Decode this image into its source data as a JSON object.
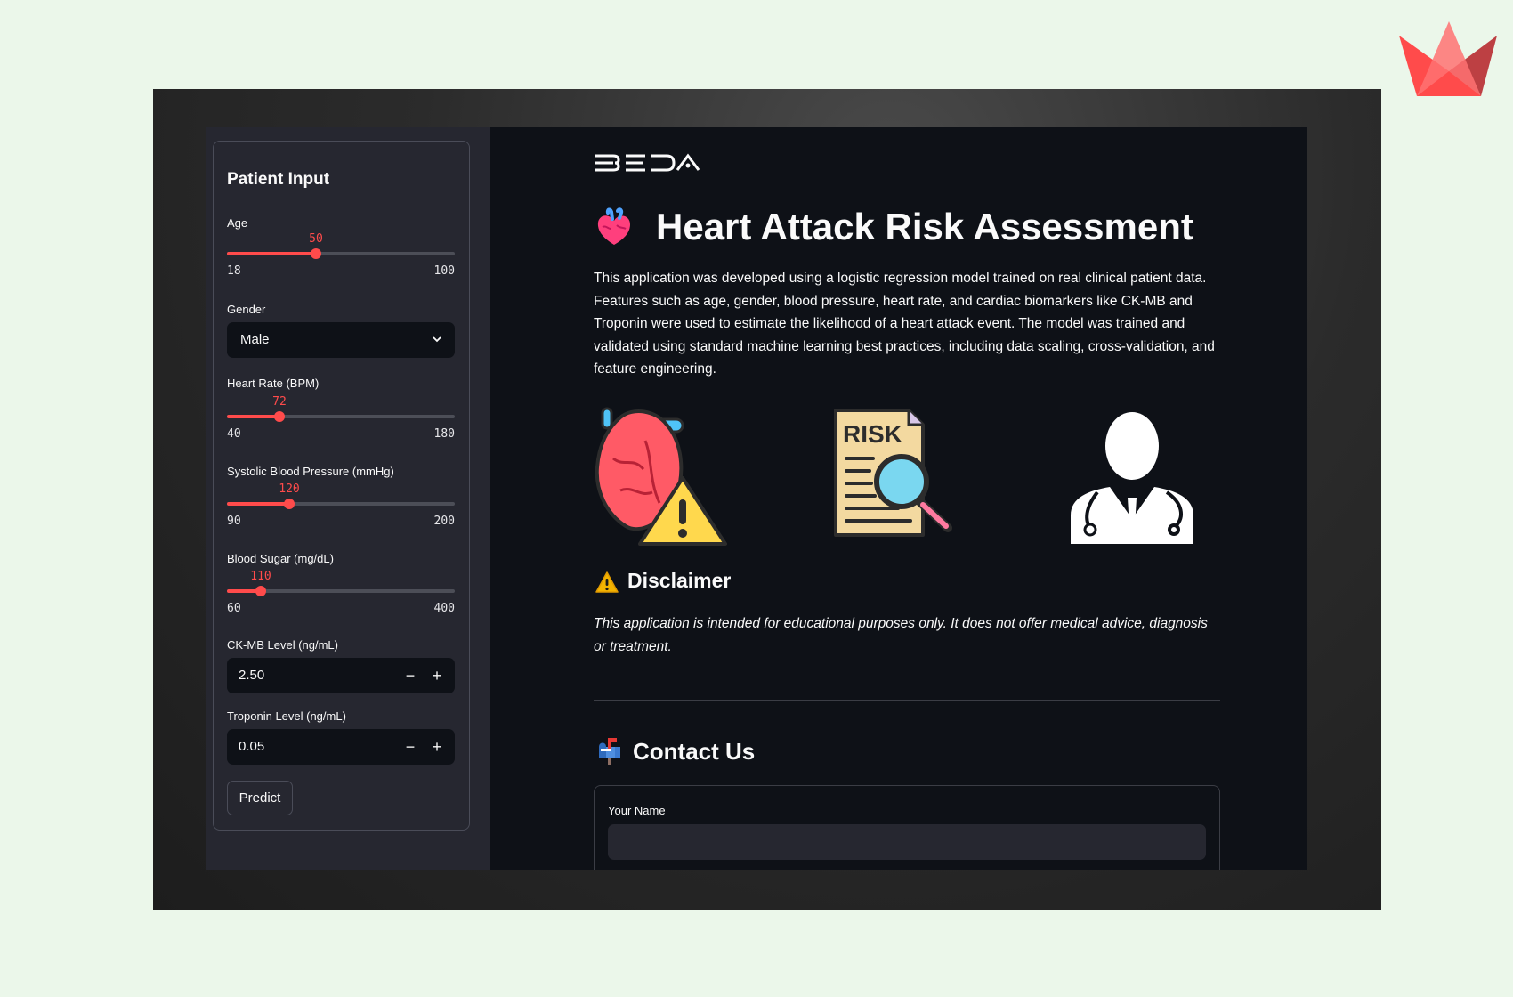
{
  "sidebar": {
    "title": "Patient Input",
    "age": {
      "label": "Age",
      "value": 50,
      "min": 18,
      "max": 100
    },
    "gender": {
      "label": "Gender",
      "selected": "Male"
    },
    "heart_rate": {
      "label": "Heart Rate (BPM)",
      "value": 72,
      "min": 40,
      "max": 180
    },
    "systolic_bp": {
      "label": "Systolic Blood Pressure (mmHg)",
      "value": 120,
      "min": 90,
      "max": 200
    },
    "blood_sugar": {
      "label": "Blood Sugar (mg/dL)",
      "value": 110,
      "min": 60,
      "max": 400
    },
    "ckmb": {
      "label": "CK-MB Level (ng/mL)",
      "value": "2.50",
      "minus": "−",
      "plus": "+"
    },
    "troponin": {
      "label": "Troponin Level (ng/mL)",
      "value": "0.05",
      "minus": "−",
      "plus": "+"
    },
    "predict_label": "Predict"
  },
  "main": {
    "logo_text": "BEDA",
    "title": "Heart Attack Risk Assessment",
    "description": "This application was developed using a logistic regression model trained on real clinical patient data. Features such as age, gender, blood pressure, heart rate, and cardiac biomarkers like CK-MB and Troponin were used to estimate the likelihood of a heart attack event. The model was trained and validated using standard machine learning best practices, including data scaling, cross-validation, and feature engineering.",
    "illustrations": {
      "risk_label": "RISK"
    },
    "disclaimer": {
      "heading": "Disclaimer",
      "text": "This application is intended for educational purposes only. It does not offer medical advice, diagnosis or treatment."
    },
    "contact": {
      "heading": "Contact Us",
      "name_label": "Your Name",
      "name_value": ""
    }
  },
  "colors": {
    "accent": "#ff4b4b",
    "app_bg": "#0e1117",
    "sidebar_bg": "#262730",
    "page_bg": "#ebf7ea"
  },
  "icons": [
    "streamlit-crown-icon",
    "beda-logo",
    "anatomical-heart-icon",
    "chevron-down-icon",
    "heart-warning-illustration",
    "risk-document-illustration",
    "doctor-illustration",
    "warning-icon",
    "mailbox-icon"
  ]
}
